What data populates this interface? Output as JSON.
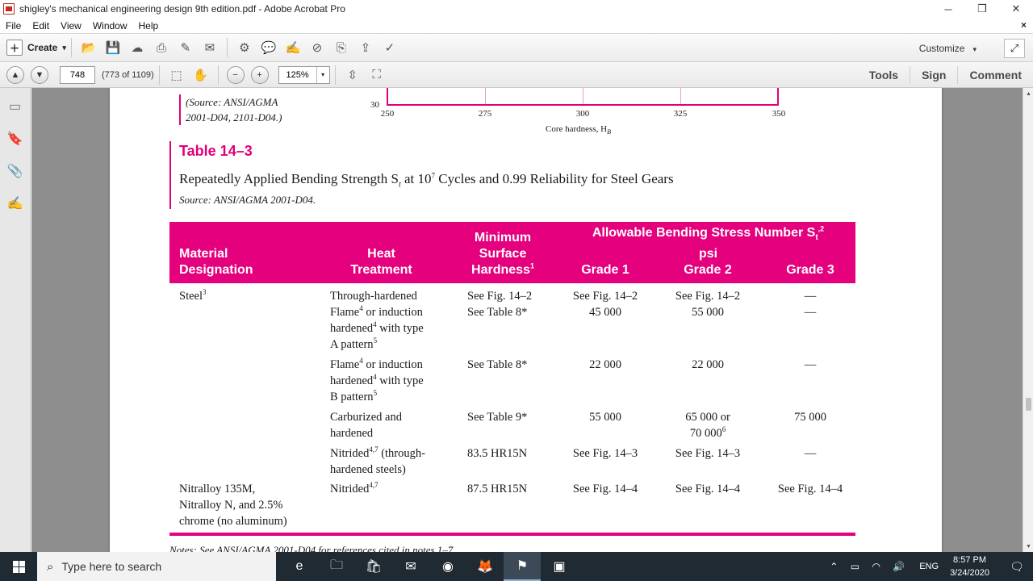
{
  "window": {
    "title": "shigley's mechanical engineering design 9th edition.pdf - Adobe Acrobat Pro",
    "minimize": "─",
    "restore": "❐",
    "close": "✕"
  },
  "menu": {
    "items": [
      "File",
      "Edit",
      "View",
      "Window",
      "Help"
    ],
    "close_doc": "×"
  },
  "toolbar": {
    "create_label": "Create",
    "create_caret": "▾",
    "customize_label": "Customize",
    "customize_caret": "▾",
    "icons": [
      "open-folder-icon",
      "save-icon",
      "upload-cloud-icon",
      "print-icon",
      "edit-icon",
      "email-icon",
      "gear-icon",
      "comment-icon",
      "sign-icon",
      "delete-page-icon",
      "page-settings-icon",
      "page-export-icon",
      "page-sign-icon"
    ]
  },
  "nav": {
    "page_number": "748",
    "page_count": "(773 of 1109)",
    "zoom": "125%",
    "zoom_caret": "▾",
    "right_tabs": [
      "Tools",
      "Sign",
      "Comment"
    ]
  },
  "document": {
    "chart_fragment": {
      "source_left_line1": "(Source: ANSI/AGMA",
      "source_left_line2": "2001-D04, 2101-D04.)",
      "y_tick": "30",
      "x_ticks": [
        "250",
        "275",
        "300",
        "325",
        "350"
      ],
      "x_label": "Core hardness, H",
      "x_label_sub": "B"
    },
    "table_number": "Table 14–3",
    "caption_part1": "Repeatedly Applied Bending Strength S",
    "caption_sub": "t",
    "caption_part2": " at 10",
    "caption_sup": "7",
    "caption_part3": " Cycles and 0.99 Reliability for Steel Gears",
    "source": "Source: ANSI/AGMA 2001-D04.",
    "headers": {
      "material_1": "Material",
      "material_2": "Designation",
      "heat_1": "Heat",
      "heat_2": "Treatment",
      "min_1": "Minimum",
      "min_2": "Surface",
      "min_3": "Hardness",
      "min_sup": "1",
      "allow_1": "Allowable Bending Stress Number S",
      "allow_sub": "t",
      "allow_sup": ",2",
      "allow_2": "psi",
      "grade1": "Grade 1",
      "grade2": "Grade 2",
      "grade3": "Grade 3"
    },
    "rows": {
      "steel": "Steel",
      "steel_sup": "3",
      "r1_heat": "Through-hardened",
      "r1_min": "See Fig. 14–2",
      "r1_g1": "See Fig. 14–2",
      "r1_g2": "See Fig. 14–2",
      "r1_g3": "—",
      "r2_heat_a": "Flame",
      "r2_heat_b": " or induction",
      "r2_heat_c": "hardened",
      "r2_heat_d": " with type",
      "r2_heat_e": "A pattern",
      "r2_min": "See Table 8*",
      "r2_g1": "45 000",
      "r2_g2": "55 000",
      "r2_g3": "—",
      "r3_heat_a": "Flame",
      "r3_heat_b": " or induction",
      "r3_heat_c": "hardened",
      "r3_heat_d": " with type",
      "r3_heat_e": "B pattern",
      "r3_min": "See Table 8*",
      "r3_g1": "22 000",
      "r3_g2": "22 000",
      "r3_g3": "—",
      "r4_heat_a": "Carburized and",
      "r4_heat_b": "hardened",
      "r4_min": "See Table 9*",
      "r4_g1": "55 000",
      "r4_g2_a": "65 000 or",
      "r4_g2_b": "70 000",
      "r4_g2_sup": "6",
      "r4_g3": "75 000",
      "r5_heat_a": "Nitrided",
      "r5_heat_sup": "4,7",
      "r5_heat_b": " (through-",
      "r5_heat_c": "hardened steels)",
      "r5_min": "83.5 HR15N",
      "r5_g1": "See Fig. 14–3",
      "r5_g2": "See Fig. 14–3",
      "r5_g3": "—",
      "r6_mat_a": "Nitralloy 135M,",
      "r6_mat_b": "Nitralloy N, and 2.5%",
      "r6_mat_c": "chrome (no aluminum)",
      "r6_heat": "Nitrided",
      "r6_heat_sup": "4,7",
      "r6_min": "87.5 HR15N",
      "r6_g1": "See Fig. 14–4",
      "r6_g2": "See Fig. 14–4",
      "r6_g3": "See Fig. 14–4",
      "sup4": "4",
      "sup5": "5"
    },
    "notes_fragment": "Notes: See ANSI/AGMA 2001-D04 for references cited in notes 1–7."
  },
  "taskbar": {
    "search_placeholder": "Type here to search",
    "lang": "ENG",
    "time": "8:57 PM",
    "date": "3/24/2020"
  },
  "colors": {
    "accent_pink": "#e5007e",
    "taskbar": "#1f2a33"
  }
}
